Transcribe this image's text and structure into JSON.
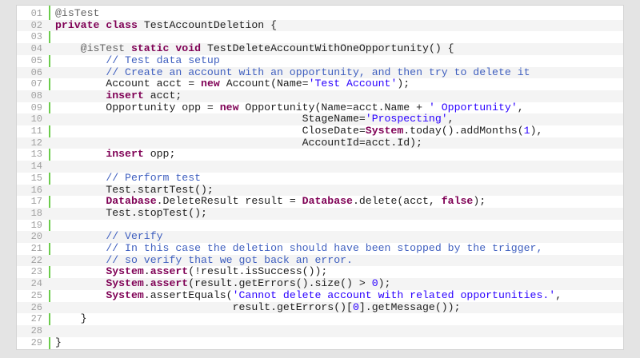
{
  "editor": {
    "lines": [
      {
        "n": "01",
        "tokens": [
          {
            "t": "an",
            "v": "@isTest"
          }
        ]
      },
      {
        "n": "02",
        "tokens": [
          {
            "t": "kw",
            "v": "private"
          },
          {
            "t": "",
            "v": " "
          },
          {
            "t": "kw",
            "v": "class"
          },
          {
            "t": "",
            "v": " TestAccountDeletion {"
          }
        ]
      },
      {
        "n": "03",
        "tokens": []
      },
      {
        "n": "04",
        "tokens": [
          {
            "t": "",
            "v": "    "
          },
          {
            "t": "an",
            "v": "@isTest"
          },
          {
            "t": "",
            "v": " "
          },
          {
            "t": "kw",
            "v": "static"
          },
          {
            "t": "",
            "v": " "
          },
          {
            "t": "kw",
            "v": "void"
          },
          {
            "t": "",
            "v": " TestDeleteAccountWithOneOpportunity() {"
          }
        ]
      },
      {
        "n": "05",
        "tokens": [
          {
            "t": "",
            "v": "        "
          },
          {
            "t": "cm",
            "v": "// Test data setup"
          }
        ]
      },
      {
        "n": "06",
        "tokens": [
          {
            "t": "",
            "v": "        "
          },
          {
            "t": "cm",
            "v": "// Create an account with an opportunity, and then try to delete it"
          }
        ]
      },
      {
        "n": "07",
        "tokens": [
          {
            "t": "",
            "v": "        Account acct = "
          },
          {
            "t": "kw",
            "v": "new"
          },
          {
            "t": "",
            "v": " Account(Name="
          },
          {
            "t": "st",
            "v": "'Test Account'"
          },
          {
            "t": "",
            "v": ");"
          }
        ]
      },
      {
        "n": "08",
        "tokens": [
          {
            "t": "",
            "v": "        "
          },
          {
            "t": "kw",
            "v": "insert"
          },
          {
            "t": "",
            "v": " acct;"
          }
        ]
      },
      {
        "n": "09",
        "tokens": [
          {
            "t": "",
            "v": "        Opportunity opp = "
          },
          {
            "t": "kw",
            "v": "new"
          },
          {
            "t": "",
            "v": " Opportunity(Name=acct.Name + "
          },
          {
            "t": "st",
            "v": "' Opportunity'"
          },
          {
            "t": "",
            "v": ","
          }
        ]
      },
      {
        "n": "10",
        "tokens": [
          {
            "t": "",
            "v": "                                       StageName="
          },
          {
            "t": "st",
            "v": "'Prospecting'"
          },
          {
            "t": "",
            "v": ","
          }
        ]
      },
      {
        "n": "11",
        "tokens": [
          {
            "t": "",
            "v": "                                       CloseDate="
          },
          {
            "t": "ty",
            "v": "System"
          },
          {
            "t": "",
            "v": ".today().addMonths("
          },
          {
            "t": "st",
            "v": "1"
          },
          {
            "t": "",
            "v": "),"
          }
        ]
      },
      {
        "n": "12",
        "tokens": [
          {
            "t": "",
            "v": "                                       AccountId=acct.Id);"
          }
        ]
      },
      {
        "n": "13",
        "tokens": [
          {
            "t": "",
            "v": "        "
          },
          {
            "t": "kw",
            "v": "insert"
          },
          {
            "t": "",
            "v": " opp;"
          }
        ]
      },
      {
        "n": "14",
        "tokens": []
      },
      {
        "n": "15",
        "tokens": [
          {
            "t": "",
            "v": "        "
          },
          {
            "t": "cm",
            "v": "// Perform test"
          }
        ]
      },
      {
        "n": "16",
        "tokens": [
          {
            "t": "",
            "v": "        Test.startTest();"
          }
        ]
      },
      {
        "n": "17",
        "tokens": [
          {
            "t": "",
            "v": "        "
          },
          {
            "t": "ty",
            "v": "Database"
          },
          {
            "t": "",
            "v": ".DeleteResult result = "
          },
          {
            "t": "ty",
            "v": "Database"
          },
          {
            "t": "",
            "v": ".delete(acct, "
          },
          {
            "t": "kw",
            "v": "false"
          },
          {
            "t": "",
            "v": ");"
          }
        ]
      },
      {
        "n": "18",
        "tokens": [
          {
            "t": "",
            "v": "        Test.stopTest();"
          }
        ]
      },
      {
        "n": "19",
        "tokens": []
      },
      {
        "n": "20",
        "tokens": [
          {
            "t": "",
            "v": "        "
          },
          {
            "t": "cm",
            "v": "// Verify"
          }
        ]
      },
      {
        "n": "21",
        "tokens": [
          {
            "t": "",
            "v": "        "
          },
          {
            "t": "cm",
            "v": "// In this case the deletion should have been stopped by the trigger,"
          }
        ]
      },
      {
        "n": "22",
        "tokens": [
          {
            "t": "",
            "v": "        "
          },
          {
            "t": "cm",
            "v": "// so verify that we got back an error."
          }
        ]
      },
      {
        "n": "23",
        "tokens": [
          {
            "t": "",
            "v": "        "
          },
          {
            "t": "ty",
            "v": "System"
          },
          {
            "t": "",
            "v": "."
          },
          {
            "t": "ty",
            "v": "assert"
          },
          {
            "t": "",
            "v": "(!result.isSuccess());"
          }
        ]
      },
      {
        "n": "24",
        "tokens": [
          {
            "t": "",
            "v": "        "
          },
          {
            "t": "ty",
            "v": "System"
          },
          {
            "t": "",
            "v": "."
          },
          {
            "t": "ty",
            "v": "assert"
          },
          {
            "t": "",
            "v": "(result.getErrors().size() > "
          },
          {
            "t": "st",
            "v": "0"
          },
          {
            "t": "",
            "v": ");"
          }
        ]
      },
      {
        "n": "25",
        "tokens": [
          {
            "t": "",
            "v": "        "
          },
          {
            "t": "ty",
            "v": "System"
          },
          {
            "t": "",
            "v": ".assertEquals("
          },
          {
            "t": "st",
            "v": "'Cannot delete account with related opportunities.'"
          },
          {
            "t": "",
            "v": ","
          }
        ]
      },
      {
        "n": "26",
        "tokens": [
          {
            "t": "",
            "v": "                            result.getErrors()["
          },
          {
            "t": "st",
            "v": "0"
          },
          {
            "t": "",
            "v": "].getMessage());"
          }
        ]
      },
      {
        "n": "27",
        "tokens": [
          {
            "t": "",
            "v": "    }"
          }
        ]
      },
      {
        "n": "28",
        "tokens": []
      },
      {
        "n": "29",
        "tokens": [
          {
            "t": "",
            "v": "}"
          }
        ]
      }
    ]
  },
  "colors": {
    "gutter_accent": "#6ccc4c",
    "keyword": "#7f0055",
    "comment": "#3f5fbf",
    "string": "#2a00ff",
    "annotation": "#646464"
  }
}
